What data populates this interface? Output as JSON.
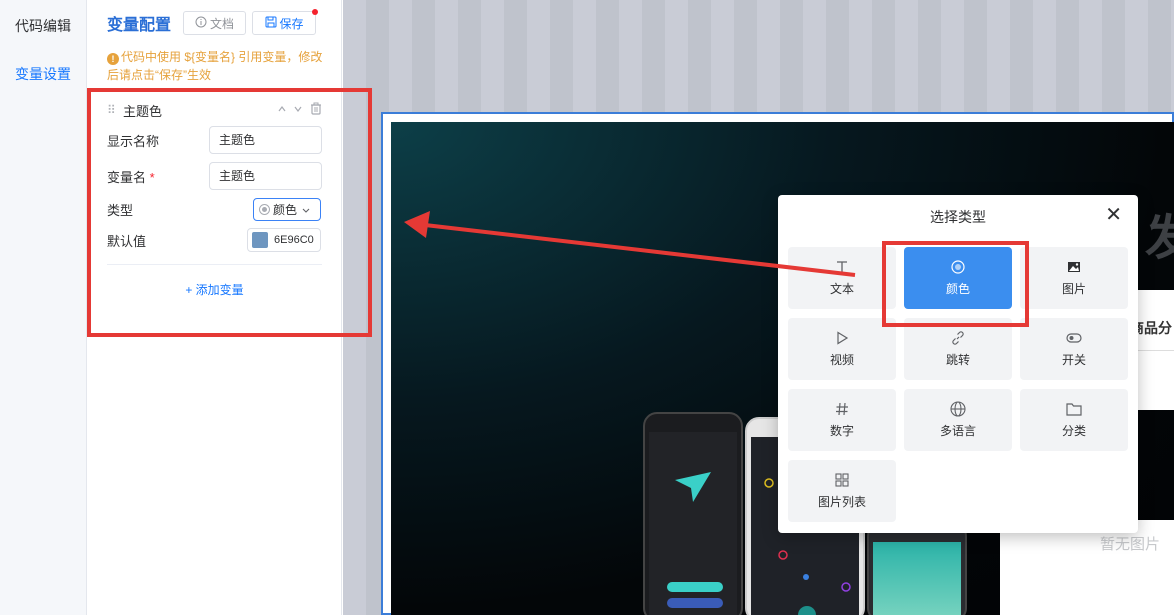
{
  "nav": {
    "items": [
      {
        "label": "代码编辑"
      },
      {
        "label": "变量设置"
      }
    ]
  },
  "panel": {
    "title": "变量配置",
    "doc_label": "文档",
    "save_label": "保存",
    "hint": "代码中使用 ${变量名} 引用变量，修改后请点击“保存”生效",
    "variable": {
      "name": "主题色",
      "display_name_label": "显示名称",
      "display_name_value": "主题色",
      "var_name_label": "变量名",
      "var_name_required": "*",
      "var_name_value": "主题色",
      "type_label": "类型",
      "type_value": "颜色",
      "default_label": "默认值",
      "default_value": "6E96C0",
      "default_color": "#6e96c0"
    },
    "add_variable": "+ 添加变量"
  },
  "preview": {
    "big_char": "发",
    "category_text": "商品分",
    "no_picture_text": "暂无图片"
  },
  "modal": {
    "title": "选择类型",
    "close": "✕",
    "types": [
      {
        "label": "文本",
        "icon": "text-icon"
      },
      {
        "label": "颜色",
        "icon": "color-icon",
        "selected": true
      },
      {
        "label": "图片",
        "icon": "image-icon"
      },
      {
        "label": "视频",
        "icon": "video-icon"
      },
      {
        "label": "跳转",
        "icon": "link-icon"
      },
      {
        "label": "开关",
        "icon": "toggle-icon"
      },
      {
        "label": "数字",
        "icon": "hash-icon"
      },
      {
        "label": "多语言",
        "icon": "globe-icon"
      },
      {
        "label": "分类",
        "icon": "folder-icon"
      },
      {
        "label": "图片列表",
        "icon": "grid-icon"
      }
    ]
  },
  "colors": {
    "accent": "#1677ff",
    "selected_tile": "#3b8eef",
    "annotation_red": "#e53935",
    "hint": "#e6a23c"
  }
}
